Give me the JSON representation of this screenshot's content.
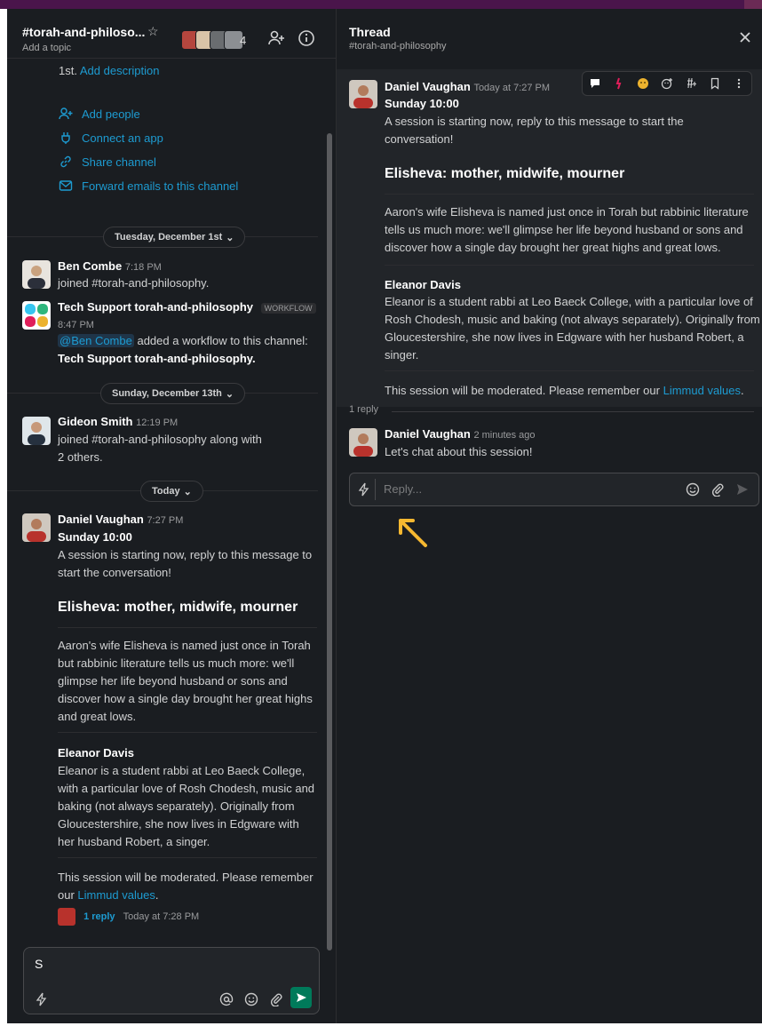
{
  "colors": {
    "sidebar_bg": "#1a1d21",
    "link": "#1d9bd1",
    "send_green": "#007a5a",
    "annotation_arrow": "#f6b830",
    "topbar": "#4a154b"
  },
  "channel": {
    "title": "#torah-and-philoso...",
    "topic": "Add a topic",
    "member_count": "4"
  },
  "intro": {
    "desc_prefix": "1st.",
    "desc_link": "Add description",
    "actions": [
      {
        "label": "Add people",
        "icon": "add-person-icon"
      },
      {
        "label": "Connect an app",
        "icon": "plug-icon"
      },
      {
        "label": "Share channel",
        "icon": "link-icon"
      },
      {
        "label": "Forward emails to this channel",
        "icon": "email-forward-icon"
      }
    ]
  },
  "dates": {
    "d1": "Tuesday, December 1st",
    "d2": "Sunday, December 13th",
    "d3": "Today"
  },
  "messages": {
    "ben": {
      "name": "Ben Combe",
      "time": "7:18 PM",
      "text": "joined #torah-and-philosophy."
    },
    "tech": {
      "name": "Tech Support torah-and-philosophy",
      "badge": "WORKFLOW",
      "time": "8:47 PM",
      "mention": "@Ben Combe",
      "text_after_mention": " added a workflow to this channel:",
      "bold_line": "Tech Support torah-and-philosophy."
    },
    "gideon": {
      "name": "Gideon Smith",
      "time": "12:19 PM",
      "line1": "joined #torah-and-philosophy along with",
      "line2": "2 others."
    },
    "daniel": {
      "name": "Daniel Vaughan",
      "time": "7:27 PM",
      "time_thread": "Today at 7:27 PM",
      "subtitle": "Sunday 10:00",
      "reply_count": "1 reply",
      "reply_time": "Today at 7:28 PM"
    }
  },
  "left_text": {
    "p1": [
      "A session is starting now, reply to this message to",
      "start the conversation!"
    ],
    "heading": "Elisheva: mother, midwife, mourner",
    "p2": [
      "Aaron's wife Elisheva is named just once in Torah",
      "but rabbinic literature tells us much more: we'll",
      "glimpse her life beyond husband or sons and",
      "discover how a single day brought her great highs",
      "and great lows."
    ],
    "speaker": "Eleanor Davis",
    "p3": [
      "Eleanor is a student rabbi at Leo Baeck College,",
      "with a particular love of Rosh Chodesh, music and",
      "baking (not always separately). Originally from",
      "Gloucestershire, she now lives in Edgware with",
      "her husband Robert, a singer."
    ],
    "p4a": "This session will be moderated. Please remember",
    "p4b_prefix": "our ",
    "p4b_link": "Limmud values",
    "p4b_suffix": "."
  },
  "composer": {
    "text": "S"
  },
  "thread": {
    "title": "Thread",
    "subtitle": "#torah-and-philosophy",
    "p1": [
      "A session is starting now, reply to this message to start the",
      "conversation!"
    ],
    "heading": "Elisheva: mother, midwife, mourner",
    "p2": [
      "Aaron's wife Elisheva is named just once in Torah but rabbinic literature",
      "tells us much more: we'll glimpse her life beyond husband or sons and",
      "discover how a single day brought her great highs and great lows."
    ],
    "speaker": "Eleanor Davis",
    "p3": [
      "Eleanor is a student rabbi at Leo Baeck College, with a particular love of",
      "Rosh Chodesh, music and baking (not always separately). Originally from",
      "Gloucestershire, she now lives in Edgware with her husband Robert, a",
      "singer."
    ],
    "p4_prefix": "This session will be moderated. Please remember our ",
    "p4_link": "Limmud values",
    "p4_suffix": ".",
    "reply_divider": "1 reply",
    "reply": {
      "name": "Daniel Vaughan",
      "time": "2 minutes ago",
      "text": "Let's chat about this session!"
    },
    "composer_placeholder": "Reply..."
  }
}
